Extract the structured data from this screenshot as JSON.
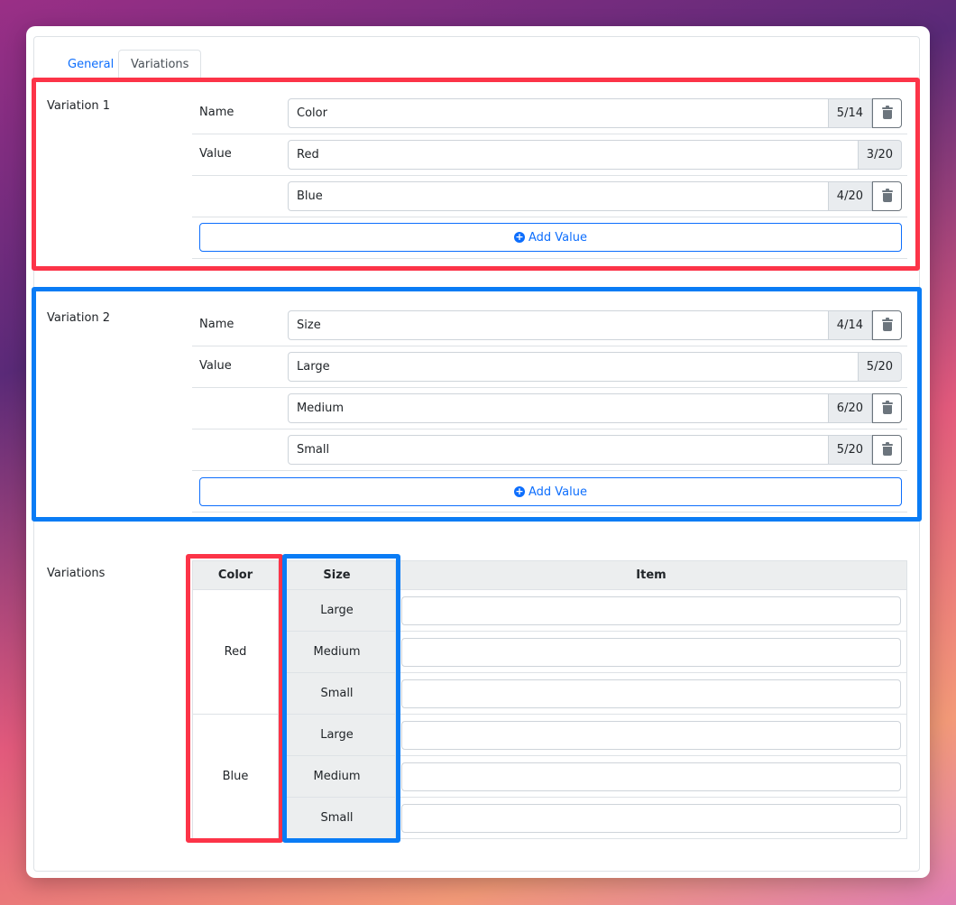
{
  "tabs": [
    {
      "label": "General"
    },
    {
      "label": "Variations"
    }
  ],
  "variation1": {
    "label": "Variation 1",
    "name_label": "Name",
    "value_label": "Value",
    "name": {
      "value": "Color",
      "count": "5/14"
    },
    "values": [
      {
        "value": "Red",
        "count": "3/20"
      },
      {
        "value": "Blue",
        "count": "4/20"
      }
    ],
    "add_label": "Add Value"
  },
  "variation2": {
    "label": "Variation 2",
    "name_label": "Name",
    "value_label": "Value",
    "name": {
      "value": "Size",
      "count": "4/14"
    },
    "values": [
      {
        "value": "Large",
        "count": "5/20"
      },
      {
        "value": "Medium",
        "count": "6/20"
      },
      {
        "value": "Small",
        "count": "5/20"
      }
    ],
    "add_label": "Add Value"
  },
  "variations_table": {
    "label": "Variations",
    "headers": [
      "Color",
      "Size",
      "Item"
    ],
    "colors": [
      "Red",
      "Blue"
    ],
    "sizes": [
      "Large",
      "Medium",
      "Small"
    ]
  },
  "colors": {
    "accent": "#0d6efd",
    "highlight_red": "#fc3448",
    "highlight_blue": "#0a7cf5"
  },
  "icons": {
    "delete": "trash-icon",
    "add": "plus-circle-icon"
  }
}
